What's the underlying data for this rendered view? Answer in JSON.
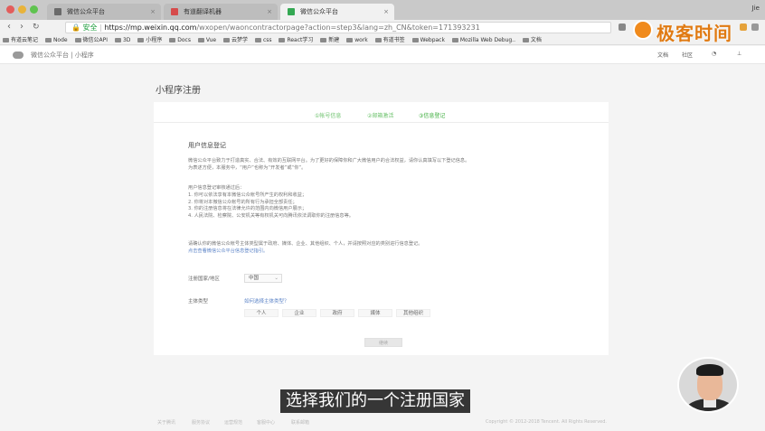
{
  "browser": {
    "tabs": [
      {
        "label": "微信公众平台",
        "active": false,
        "favicon_color": "#6a6a6a"
      },
      {
        "label": "有道翻译机器",
        "active": false,
        "favicon_color": "#d64b4b"
      },
      {
        "label": "微信公众平台",
        "active": true,
        "favicon_color": "#34a853"
      }
    ],
    "user_name": "Jie",
    "secure_label": "安全",
    "url_main": "https://mp.weixin.qq.com",
    "url_rest": "/wxopen/waoncontractorpage?action=step3&lang=zh_CN&token=171393231",
    "bookmarks": [
      "有道云笔记",
      "Node",
      "微信公API",
      "3D",
      "小程序",
      "Docs",
      "Vue",
      "云梦学",
      "css",
      "React学习",
      "新建",
      "work",
      "有道书签",
      "Webpack",
      "Mozilla Web Debug..",
      "文档"
    ]
  },
  "brand": {
    "text": "极客时间"
  },
  "header": {
    "title": "微信公众平台 | 小程序",
    "links": [
      "文档",
      "社区"
    ]
  },
  "page": {
    "title": "小程序注册",
    "steps": [
      "①帐号信息",
      "②邮箱激活",
      "③信息登记"
    ],
    "section_title": "用户信息登记",
    "intro": [
      "微信公众平台致力于打造真实、合法、有效的互联网平台。为了更好的保障你和广大微信用户的合法权益，请你认真填写以下登记信息。",
      "为表述方便，本服务中，“用户”也称为“开发者”或“你”。"
    ],
    "notes_title": "用户信息登记审核通过后：",
    "notes": [
      "1. 你可以依法享有本微信公众帐号所产生的权利和收益；",
      "2. 你将对本微信公众帐号的所有行为承担全部责任；",
      "3. 你的注册信息将在法律允许的范围内向微信用户展示；",
      "4. 人民法院、检察院、公安机关等有权机关可向腾讯依法调取你的注册信息等。"
    ],
    "confirm_text": "请确认你的微信公众帐号主体类型属于政府、媒体、企业、其他组织、个人，并请按照对应的类别进行信息登记。",
    "confirm_link": "点击查看微信公众平台信息登记指引。",
    "region_label": "注册国家/地区",
    "region_value": "中国",
    "type_label": "主体类型",
    "type_link": "如何选择主体类型？",
    "type_options": [
      "个人",
      "企业",
      "政府",
      "媒体",
      "其他组织"
    ],
    "submit_label": "继续"
  },
  "footer": {
    "links": [
      "关于腾讯",
      "服务协议",
      "运营规范",
      "客服中心",
      "联系邮箱"
    ],
    "copyright": "Copyright © 2012-2018 Tencent. All Rights Reserved."
  },
  "subtitle": "选择我们的一个注册国家"
}
